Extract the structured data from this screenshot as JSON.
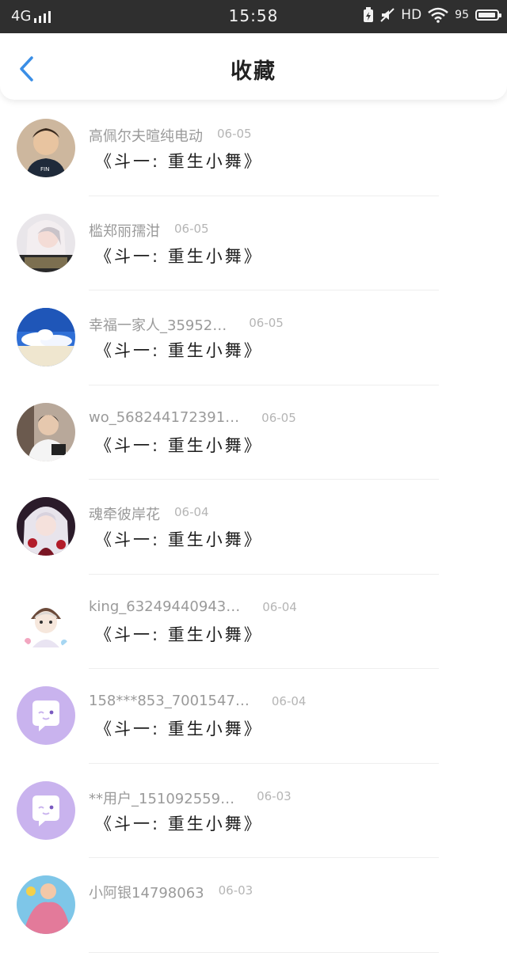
{
  "status_bar": {
    "network": "4G",
    "time": "15:58",
    "hd": "HD",
    "battery_text": "95",
    "battery_level": 0.95
  },
  "nav": {
    "title": "收藏"
  },
  "items": [
    {
      "username": "高佩尔夫暄纯电动",
      "date": "06-05",
      "title": "《斗一: 重生小舞》"
    },
    {
      "username": "槛郑丽孺泔",
      "date": "06-05",
      "title": "《斗一: 重生小舞》"
    },
    {
      "username": "幸福一家人_35952…",
      "date": "06-05",
      "title": "《斗一: 重生小舞》"
    },
    {
      "username": "wo_568244172391…",
      "date": "06-05",
      "title": "《斗一: 重生小舞》"
    },
    {
      "username": "魂牵彼岸花",
      "date": "06-04",
      "title": "《斗一: 重生小舞》"
    },
    {
      "username": "king_63249440943…",
      "date": "06-04",
      "title": "《斗一: 重生小舞》"
    },
    {
      "username": "158***853_7001547…",
      "date": "06-04",
      "title": "《斗一: 重生小舞》"
    },
    {
      "username": "**用户_151092559…",
      "date": "06-03",
      "title": "《斗一: 重生小舞》"
    },
    {
      "username": "小阿银14798063",
      "date": "06-03",
      "title": ""
    }
  ],
  "avatar_icons": [
    "boy-photo-avatar",
    "girl-photo-avatar",
    "sky-photo-avatar",
    "man-photo-avatar",
    "anime-girl-avatar",
    "chibi-avatar",
    "default-chat-avatar",
    "default-chat-avatar",
    "photo-avatar"
  ],
  "colors": {
    "status_bar_bg": "#2f2f2f",
    "accent": "#3a8ee6",
    "default_avatar_bg": "#c9b3ee"
  }
}
